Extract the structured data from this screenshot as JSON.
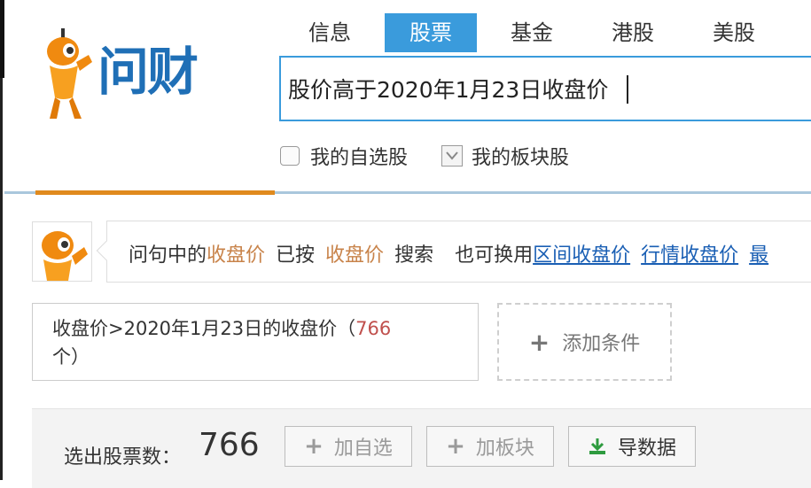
{
  "logo": {
    "text": "问财"
  },
  "tabs": [
    {
      "label": "信息",
      "active": false
    },
    {
      "label": "股票",
      "active": true
    },
    {
      "label": "基金",
      "active": false
    },
    {
      "label": "港股",
      "active": false
    },
    {
      "label": "美股",
      "active": false
    }
  ],
  "search": {
    "value": "股价高于2020年1月23日收盘价"
  },
  "options": {
    "my_watchlist": "我的自选股",
    "my_sector": "我的板块股"
  },
  "notice": {
    "prefix": "问句中的",
    "term1": "收盘价",
    "middle": "已按",
    "term2": "收盘价",
    "suffix": "搜索",
    "alt_prefix": "也可换用",
    "link1": "区间收盘价",
    "link2": "行情收盘价",
    "link3": "最"
  },
  "condition": {
    "text": "收盘价>2020年1月23日的收盘价（",
    "count": "766",
    "unit": "个）"
  },
  "add_condition": "添加条件",
  "result": {
    "count_label": "选出股票数：",
    "count_value": "766",
    "add_watchlist": "加自选",
    "add_sector": "加板块",
    "export": "导数据"
  },
  "colors": {
    "accent_blue": "#3a9bdc",
    "logo_blue": "#1f6fb6",
    "orange": "#e08a1e",
    "highlight_term": "#c8834a",
    "link": "#1a5fb4",
    "count_red": "#c0504d",
    "export_green": "#2e9b3f"
  }
}
